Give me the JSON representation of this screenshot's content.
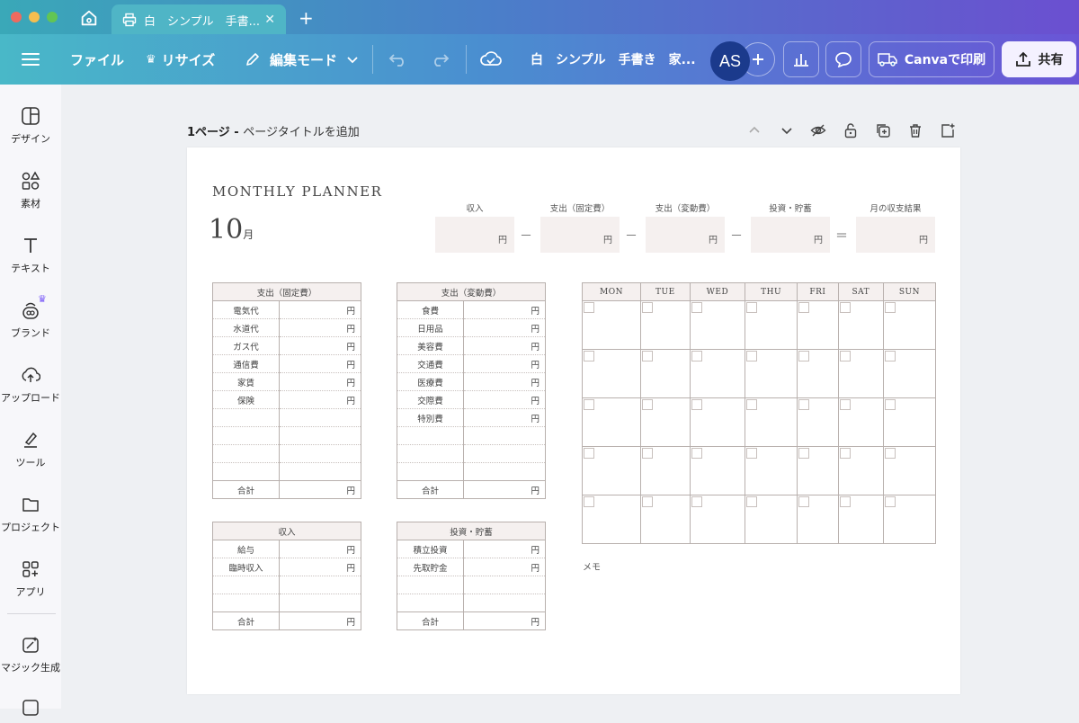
{
  "tab": {
    "title": "白　シンプル　手書..."
  },
  "toolbar": {
    "file": "ファイル",
    "resize": "リサイズ",
    "edit_mode": "編集モード",
    "doc_title": "白　シンプル　手書き　家...",
    "avatar": "AS",
    "print": "Canvaで印刷",
    "share": "共有"
  },
  "sidebar": [
    {
      "label": "デザイン",
      "icon": "design-icon"
    },
    {
      "label": "素材",
      "icon": "elements-icon"
    },
    {
      "label": "テキスト",
      "icon": "text-icon"
    },
    {
      "label": "ブランド",
      "icon": "brand-icon"
    },
    {
      "label": "アップロード",
      "icon": "upload-icon"
    },
    {
      "label": "ツール",
      "icon": "tools-icon"
    },
    {
      "label": "プロジェクト",
      "icon": "folder-icon"
    },
    {
      "label": "アプリ",
      "icon": "apps-icon"
    },
    {
      "label": "マジック生成",
      "icon": "magic-icon"
    }
  ],
  "page_bar": {
    "page": "1ページ - ",
    "title": "ページタイトルを追加"
  },
  "planner": {
    "title": "MONTHLY PLANNER",
    "month": "10",
    "month_unit": "月",
    "yen": "円",
    "total": "合計",
    "summary": [
      "収入",
      "支出（固定費）",
      "支出（変動費）",
      "投資・貯蓄",
      "月の収支結果"
    ],
    "ops": [
      "－",
      "－",
      "－",
      "＝"
    ],
    "fixed": {
      "header": "支出（固定費）",
      "items": [
        "電気代",
        "水道代",
        "ガス代",
        "通信費",
        "家賃",
        "保険"
      ]
    },
    "variable": {
      "header": "支出（変動費）",
      "items": [
        "食費",
        "日用品",
        "美容費",
        "交通費",
        "医療費",
        "交際費",
        "特別費"
      ]
    },
    "income": {
      "header": "収入",
      "items": [
        "給与",
        "臨時収入"
      ]
    },
    "invest": {
      "header": "投資・貯蓄",
      "items": [
        "積立投資",
        "先取貯金"
      ]
    },
    "weekdays": [
      "MON",
      "TUE",
      "WED",
      "THU",
      "FRI",
      "SAT",
      "SUN"
    ],
    "memo": "メモ"
  }
}
